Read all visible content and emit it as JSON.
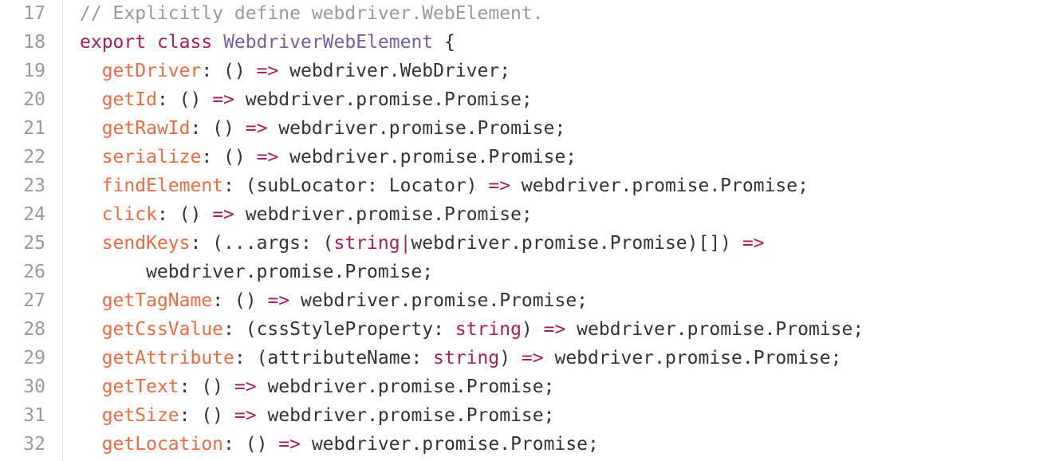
{
  "theme": {
    "default": "#333333",
    "comment": "#999999",
    "keyword": "#a71d5d",
    "class_name": "#795da3",
    "property": "#ed6a43",
    "operator": "#a71d5d",
    "type": "#a71d5d",
    "line_number": "#9a9a9a"
  },
  "editor": {
    "lines": [
      {
        "number": "17",
        "tokens": [
          {
            "text": "// Explicitly define webdriver.WebElement.",
            "kind": "comment"
          }
        ]
      },
      {
        "number": "18",
        "tokens": [
          {
            "text": "export",
            "kind": "keyword"
          },
          {
            "text": " ",
            "kind": "default"
          },
          {
            "text": "class",
            "kind": "keyword"
          },
          {
            "text": " ",
            "kind": "default"
          },
          {
            "text": "WebdriverWebElement",
            "kind": "class_name"
          },
          {
            "text": " {",
            "kind": "default"
          }
        ]
      },
      {
        "number": "19",
        "tokens": [
          {
            "text": "  ",
            "kind": "default"
          },
          {
            "text": "getDriver",
            "kind": "property"
          },
          {
            "text": ": () ",
            "kind": "default"
          },
          {
            "text": "=>",
            "kind": "operator"
          },
          {
            "text": " webdriver.WebDriver;",
            "kind": "default"
          }
        ]
      },
      {
        "number": "20",
        "tokens": [
          {
            "text": "  ",
            "kind": "default"
          },
          {
            "text": "getId",
            "kind": "property"
          },
          {
            "text": ": () ",
            "kind": "default"
          },
          {
            "text": "=>",
            "kind": "operator"
          },
          {
            "text": " webdriver.promise.Promise;",
            "kind": "default"
          }
        ]
      },
      {
        "number": "21",
        "tokens": [
          {
            "text": "  ",
            "kind": "default"
          },
          {
            "text": "getRawId",
            "kind": "property"
          },
          {
            "text": ": () ",
            "kind": "default"
          },
          {
            "text": "=>",
            "kind": "operator"
          },
          {
            "text": " webdriver.promise.Promise;",
            "kind": "default"
          }
        ]
      },
      {
        "number": "22",
        "tokens": [
          {
            "text": "  ",
            "kind": "default"
          },
          {
            "text": "serialize",
            "kind": "property"
          },
          {
            "text": ": () ",
            "kind": "default"
          },
          {
            "text": "=>",
            "kind": "operator"
          },
          {
            "text": " webdriver.promise.Promise;",
            "kind": "default"
          }
        ]
      },
      {
        "number": "23",
        "tokens": [
          {
            "text": "  ",
            "kind": "default"
          },
          {
            "text": "findElement",
            "kind": "property"
          },
          {
            "text": ": (subLocator: Locator) ",
            "kind": "default"
          },
          {
            "text": "=>",
            "kind": "operator"
          },
          {
            "text": " webdriver.promise.Promise;",
            "kind": "default"
          }
        ]
      },
      {
        "number": "24",
        "tokens": [
          {
            "text": "  ",
            "kind": "default"
          },
          {
            "text": "click",
            "kind": "property"
          },
          {
            "text": ": () ",
            "kind": "default"
          },
          {
            "text": "=>",
            "kind": "operator"
          },
          {
            "text": " webdriver.promise.Promise;",
            "kind": "default"
          }
        ]
      },
      {
        "number": "25",
        "tokens": [
          {
            "text": "  ",
            "kind": "default"
          },
          {
            "text": "sendKeys",
            "kind": "property"
          },
          {
            "text": ": (...args: (",
            "kind": "default"
          },
          {
            "text": "string",
            "kind": "type"
          },
          {
            "text": "|",
            "kind": "operator"
          },
          {
            "text": "webdriver.promise.Promise)[]) ",
            "kind": "default"
          },
          {
            "text": "=>",
            "kind": "operator"
          }
        ]
      },
      {
        "number": "26",
        "tokens": [
          {
            "text": "      webdriver.promise.Promise;",
            "kind": "default"
          }
        ]
      },
      {
        "number": "27",
        "tokens": [
          {
            "text": "  ",
            "kind": "default"
          },
          {
            "text": "getTagName",
            "kind": "property"
          },
          {
            "text": ": () ",
            "kind": "default"
          },
          {
            "text": "=>",
            "kind": "operator"
          },
          {
            "text": " webdriver.promise.Promise;",
            "kind": "default"
          }
        ]
      },
      {
        "number": "28",
        "tokens": [
          {
            "text": "  ",
            "kind": "default"
          },
          {
            "text": "getCssValue",
            "kind": "property"
          },
          {
            "text": ": (cssStyleProperty: ",
            "kind": "default"
          },
          {
            "text": "string",
            "kind": "type"
          },
          {
            "text": ") ",
            "kind": "default"
          },
          {
            "text": "=>",
            "kind": "operator"
          },
          {
            "text": " webdriver.promise.Promise;",
            "kind": "default"
          }
        ]
      },
      {
        "number": "29",
        "tokens": [
          {
            "text": "  ",
            "kind": "default"
          },
          {
            "text": "getAttribute",
            "kind": "property"
          },
          {
            "text": ": (attributeName: ",
            "kind": "default"
          },
          {
            "text": "string",
            "kind": "type"
          },
          {
            "text": ") ",
            "kind": "default"
          },
          {
            "text": "=>",
            "kind": "operator"
          },
          {
            "text": " webdriver.promise.Promise;",
            "kind": "default"
          }
        ]
      },
      {
        "number": "30",
        "tokens": [
          {
            "text": "  ",
            "kind": "default"
          },
          {
            "text": "getText",
            "kind": "property"
          },
          {
            "text": ": () ",
            "kind": "default"
          },
          {
            "text": "=>",
            "kind": "operator"
          },
          {
            "text": " webdriver.promise.Promise;",
            "kind": "default"
          }
        ]
      },
      {
        "number": "31",
        "tokens": [
          {
            "text": "  ",
            "kind": "default"
          },
          {
            "text": "getSize",
            "kind": "property"
          },
          {
            "text": ": () ",
            "kind": "default"
          },
          {
            "text": "=>",
            "kind": "operator"
          },
          {
            "text": " webdriver.promise.Promise;",
            "kind": "default"
          }
        ]
      },
      {
        "number": "32",
        "tokens": [
          {
            "text": "  ",
            "kind": "default"
          },
          {
            "text": "getLocation",
            "kind": "property"
          },
          {
            "text": ": () ",
            "kind": "default"
          },
          {
            "text": "=>",
            "kind": "operator"
          },
          {
            "text": " webdriver.promise.Promise;",
            "kind": "default"
          }
        ]
      }
    ]
  }
}
